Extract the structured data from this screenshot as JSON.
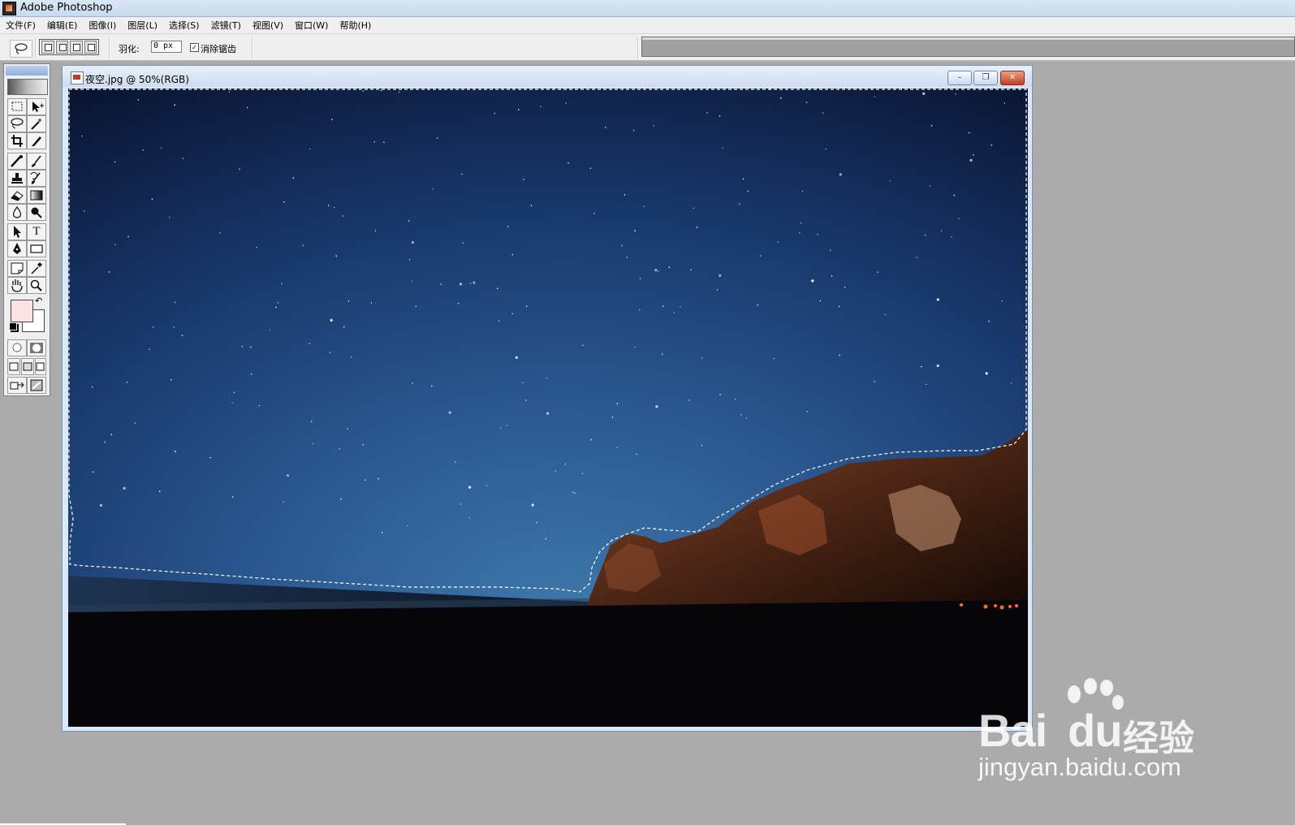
{
  "window": {
    "title": "Adobe Photoshop",
    "icon": "photoshop-icon"
  },
  "menubar": {
    "items": [
      {
        "label": "文件(F)"
      },
      {
        "label": "编辑(E)"
      },
      {
        "label": "图像(I)"
      },
      {
        "label": "图层(L)"
      },
      {
        "label": "选择(S)"
      },
      {
        "label": "滤镜(T)"
      },
      {
        "label": "视图(V)"
      },
      {
        "label": "窗口(W)"
      },
      {
        "label": "帮助(H)"
      }
    ]
  },
  "options": {
    "current_tool": "lasso-icon",
    "feather_label": "羽化:",
    "feather_value": "0 px",
    "antialias_checked": true,
    "antialias_mark": "✓",
    "antialias_label": "消除锯齿"
  },
  "toolbox": {
    "tools": [
      "marquee-icon",
      "move-icon",
      "lasso-icon",
      "magic-wand-icon",
      "crop-icon",
      "slice-icon",
      "healing-brush-icon",
      "brush-icon",
      "clone-stamp-icon",
      "history-brush-icon",
      "eraser-icon",
      "gradient-icon",
      "blur-icon",
      "dodge-icon",
      "path-select-icon",
      "type-icon",
      "pen-icon",
      "shape-icon",
      "notes-icon",
      "eyedropper-icon",
      "hand-icon",
      "zoom-icon"
    ],
    "type_glyph": "T",
    "foreground_color": "#ffe2e2",
    "background_color": "#ffffff"
  },
  "document": {
    "title": "夜空.jpg @ 50%(RGB)",
    "minimize": "–",
    "restore": "❐",
    "close": "✕"
  },
  "watermark": {
    "brand": "Bai",
    "brand_suffix": "du",
    "cn": "经验",
    "url": "jingyan.baidu.com"
  }
}
